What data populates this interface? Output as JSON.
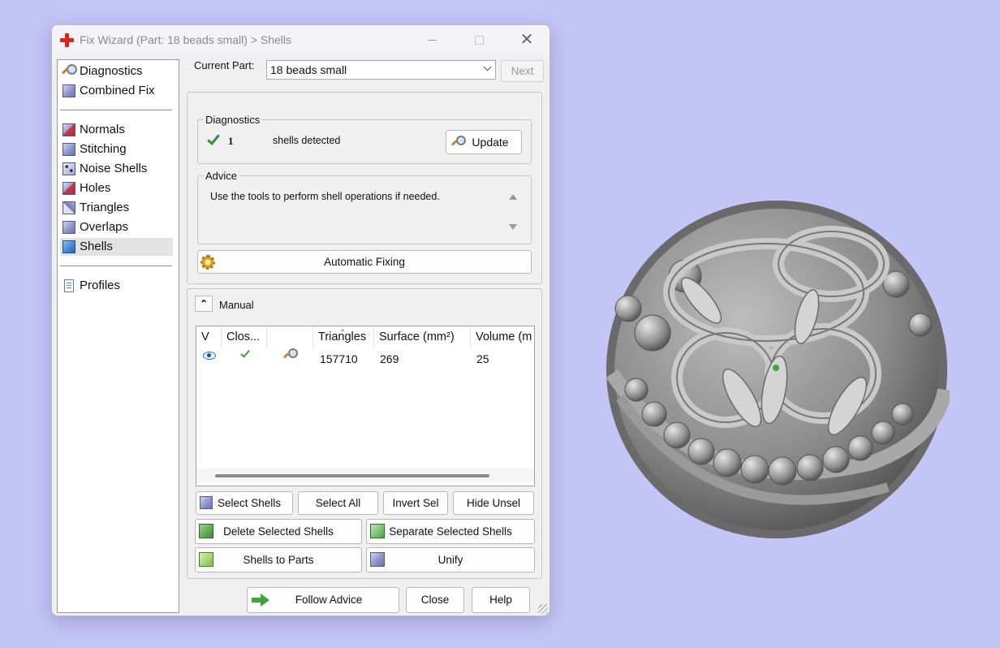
{
  "window": {
    "title": "Fix Wizard (Part: 18 beads small) > Shells",
    "controls": {
      "minimize": "—",
      "maximize": "☐",
      "close": "✕"
    }
  },
  "sidebar": {
    "items": [
      {
        "label": "Diagnostics",
        "icon": "magnifier-icon"
      },
      {
        "label": "Combined Fix",
        "icon": "cube-icon"
      },
      {
        "label": "Normals",
        "icon": "normals-cube-icon"
      },
      {
        "label": "Stitching",
        "icon": "stitching-cube-icon"
      },
      {
        "label": "Noise Shells",
        "icon": "noise-shells-icon"
      },
      {
        "label": "Holes",
        "icon": "holes-cube-icon"
      },
      {
        "label": "Triangles",
        "icon": "triangles-cube-icon"
      },
      {
        "label": "Overlaps",
        "icon": "overlaps-cube-icon"
      },
      {
        "label": "Shells",
        "icon": "shells-cube-icon",
        "selected": true
      },
      {
        "label": "Profiles",
        "icon": "document-icon"
      }
    ]
  },
  "header": {
    "current_part_label": "Current Part:",
    "current_part_value": "18 beads small",
    "next_label": "Next"
  },
  "diagnostics": {
    "title": "Diagnostics",
    "count": "1",
    "status_text": "shells detected",
    "update_label": "Update"
  },
  "advice": {
    "title": "Advice",
    "text": "Use the tools to perform shell operations if needed."
  },
  "automatic_fixing_label": "Automatic Fixing",
  "manual": {
    "title": "Manual",
    "collapse_glyph": "⌃",
    "columns": [
      "V",
      "Clos...",
      "",
      "Triangles",
      "Surface (mm²)",
      "Volume (m"
    ],
    "rows": [
      {
        "triangles": "157710",
        "surface": "269",
        "volume": "25"
      }
    ]
  },
  "buttons": {
    "select_shells": "Select Shells",
    "select_all": "Select All",
    "invert_sel": "Invert Sel",
    "hide_unsel": "Hide Unsel",
    "delete_selected": "Delete Selected Shells",
    "separate_selected": "Separate Selected Shells",
    "shells_to_parts": "Shells to Parts",
    "unify": "Unify",
    "follow_advice": "Follow Advice",
    "close": "Close",
    "help": "Help"
  },
  "colors": {
    "background": "#c4c5f7",
    "accent_check": "#3e8a3e",
    "close_cross": "#e0241b"
  }
}
